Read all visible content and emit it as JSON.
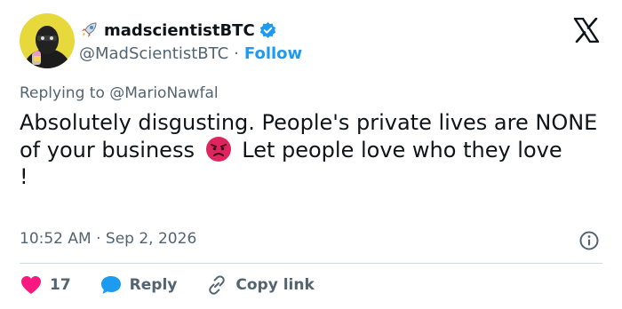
{
  "author": {
    "emoji": "rocket",
    "display_name": "madscientistBTC",
    "handle": "@MadScientistBTC",
    "separator": "·",
    "follow_label": "Follow",
    "verified": true
  },
  "reply_context": {
    "prefix": "Replying to",
    "mention": "@MarioNawfal"
  },
  "tweet": {
    "text_part1": "Absolutely disgusting. People's private lives are NONE of your business",
    "emoji": "angry-face",
    "text_part2": " Let people love who they love\n!"
  },
  "meta": {
    "time": "10:52 AM",
    "separator": "·",
    "date": "Sep 2, 2026"
  },
  "actions": {
    "like_count": "17",
    "reply_label": "Reply",
    "copy_label": "Copy link"
  },
  "colors": {
    "accent": "#1d9bf0",
    "like": "#f91880",
    "text": "#0f1419",
    "muted": "#536471"
  }
}
